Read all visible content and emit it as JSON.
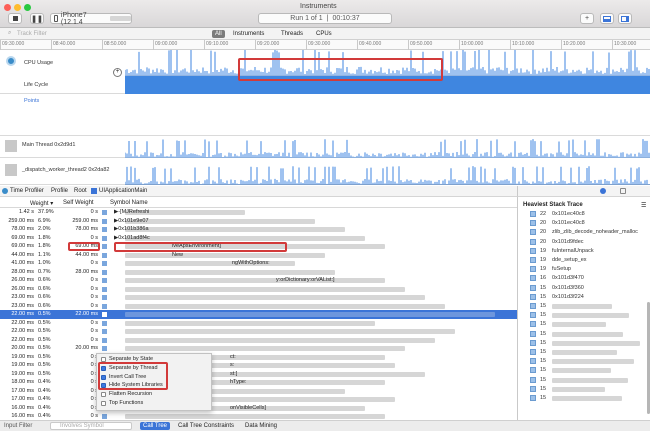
{
  "window": {
    "title": "Instruments",
    "device": "iPhone7 (12.1.4",
    "status": "Run 1 of 1",
    "timer": "00:10:37"
  },
  "filterbar": {
    "placeholder": "Track Filter",
    "tabs": [
      "All",
      "Instruments",
      "Threads",
      "CPUs"
    ]
  },
  "ruler": {
    "labels": [
      "09:30.000",
      "08:40.000",
      "08:50.000",
      "09:00.000",
      "09:10.000",
      "09:20.000",
      "09:30.000",
      "09:40.000",
      "09:50.000",
      "10:00.000",
      "10:10.000",
      "10:20.000",
      "10:30.000"
    ]
  },
  "tracks": {
    "cpu": "CPU Usage",
    "lifecycle": "Life Cycle",
    "points": "Points",
    "main_thread": "Main Thread  0x2d9d1",
    "dispatch": "_dispatch_worker_thread2  0x2da82"
  },
  "breadcrumb": {
    "items": [
      "Time Profiler",
      "Profile",
      "Root",
      "UIApplicationMain"
    ]
  },
  "columns": {
    "weight": "Weight",
    "self_weight": "Self Weight",
    "symbol": "Symbol Name"
  },
  "rows": [
    {
      "w": "1.42 s",
      "p": "37.9%",
      "s": "0 s",
      "sym": "▶-[MJRefreshi"
    },
    {
      "w": "259.00 ms",
      "p": "6.9%",
      "s": "259.00 ms",
      "sym": "▶0x101e9e07"
    },
    {
      "w": "78.00 ms",
      "p": "2.0%",
      "s": "78.00 ms",
      "sym": "▶0x101b386a"
    },
    {
      "w": "69.00 ms",
      "p": "1.8%",
      "s": "0 s",
      "sym": "▶0x101ad8f4c"
    },
    {
      "w": "69.00 ms",
      "p": "1.8%",
      "s": "69.00 ms",
      "sym": "iveApsEnvironment]"
    },
    {
      "w": "44.00 ms",
      "p": "1.1%",
      "s": "44.00 ms",
      "sym": "New"
    },
    {
      "w": "41.00 ms",
      "p": "1.0%",
      "s": "0 s",
      "sym": "ngWithOptions:"
    },
    {
      "w": "28.00 ms",
      "p": "0.7%",
      "s": "28.00 ms",
      "sym": ""
    },
    {
      "w": "26.00 ms",
      "p": "0.6%",
      "s": "0 s",
      "sym": "y:orDictionary:orVAList:]"
    },
    {
      "w": "26.00 ms",
      "p": "0.6%",
      "s": "0 s",
      "sym": ""
    },
    {
      "w": "23.00 ms",
      "p": "0.6%",
      "s": "0 s",
      "sym": ""
    },
    {
      "w": "23.00 ms",
      "p": "0.6%",
      "s": "0 s",
      "sym": ""
    },
    {
      "w": "22.00 ms",
      "p": "0.5%",
      "s": "22.00 ms",
      "sym": ""
    },
    {
      "w": "22.00 ms",
      "p": "0.5%",
      "s": "0 s",
      "sym": ""
    },
    {
      "w": "22.00 ms",
      "p": "0.5%",
      "s": "0 s",
      "sym": ""
    },
    {
      "w": "22.00 ms",
      "p": "0.5%",
      "s": "0 s",
      "sym": ""
    },
    {
      "w": "20.00 ms",
      "p": "0.5%",
      "s": "20.00 ms",
      "sym": ""
    },
    {
      "w": "19.00 ms",
      "p": "0.5%",
      "s": "0 s",
      "sym": "ct:"
    },
    {
      "w": "19.00 ms",
      "p": "0.5%",
      "s": "0 s",
      "sym": "s:"
    },
    {
      "w": "19.00 ms",
      "p": "0.5%",
      "s": "0 s",
      "sym": "st:]"
    },
    {
      "w": "18.00 ms",
      "p": "0.4%",
      "s": "0 s",
      "sym": "hType:"
    },
    {
      "w": "17.00 ms",
      "p": "0.4%",
      "s": "0 s",
      "sym": ""
    },
    {
      "w": "17.00 ms",
      "p": "0.4%",
      "s": "0 s",
      "sym": ""
    },
    {
      "w": "16.00 ms",
      "p": "0.4%",
      "s": "0 s",
      "sym": "onVisibleCells]"
    },
    {
      "w": "16.00 ms",
      "p": "0.4%",
      "s": "0 s",
      "sym": ""
    }
  ],
  "menu": {
    "items": [
      "Separate by State",
      "Separate by Thread",
      "Invert Call Tree",
      "Hide System Libraries",
      "Flatten Recursion",
      "Top Functions"
    ]
  },
  "bottom": {
    "input_filter": "Input Filter",
    "placeholder": "Involves Symbol",
    "tabs": [
      "Call Tree",
      "Call Tree Constraints",
      "Data Mining"
    ]
  },
  "stack": {
    "title": "Heaviest Stack Trace",
    "items": [
      {
        "n": "22",
        "t": "0x101ec40c8"
      },
      {
        "n": "20",
        "t": "0x101ec40c8"
      },
      {
        "n": "20",
        "t": "zlib_zlib_decode_noheader_malloc"
      },
      {
        "n": "20",
        "t": "0x101d9fdec"
      },
      {
        "n": "19",
        "t": "fuInternalUnpack"
      },
      {
        "n": "19",
        "t": "dde_setup_ex"
      },
      {
        "n": "19",
        "t": "fuSetup"
      },
      {
        "n": "16",
        "t": "0x101d3f470"
      },
      {
        "n": "15",
        "t": "0x101d3f360"
      },
      {
        "n": "15",
        "t": "0x101d3f224"
      },
      {
        "n": "15",
        "t": ""
      },
      {
        "n": "15",
        "t": ""
      },
      {
        "n": "15",
        "t": ""
      },
      {
        "n": "15",
        "t": ""
      },
      {
        "n": "15",
        "t": ""
      },
      {
        "n": "15",
        "t": ""
      },
      {
        "n": "15",
        "t": ""
      },
      {
        "n": "15",
        "t": ""
      },
      {
        "n": "15",
        "t": ""
      },
      {
        "n": "15",
        "t": ""
      },
      {
        "n": "15",
        "t": ""
      }
    ]
  },
  "colors": {
    "accent": "#3b74d7",
    "highlight": "#d23a3a",
    "cpu_fill": "#3f86e0"
  }
}
